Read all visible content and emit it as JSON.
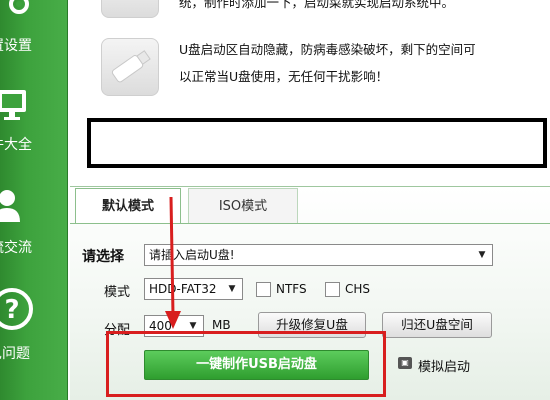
{
  "sidebar": {
    "items": [
      {
        "label": "置设置",
        "icon": "gear-icon"
      },
      {
        "label": "件大全",
        "icon": "monitor-icon"
      },
      {
        "label": "流交流",
        "icon": "user-icon"
      },
      {
        "label": "见问题",
        "icon": "question-icon"
      }
    ]
  },
  "features": {
    "line0": "统，制作时添加一下，启动菜就实现启动系统中。",
    "desc_line1": "U盘启动区自动隐藏，防病毒感染破坏，剩下的空间可",
    "desc_line2": "以正常当U盘使用，无任何干扰影响！",
    "usb_icon": "usb-drive-icon"
  },
  "tabs": [
    {
      "label": "默认模式",
      "active": true
    },
    {
      "label": "ISO模式",
      "active": false
    }
  ],
  "form": {
    "select_label": "请选择",
    "select_value": "请插入启动U盘!",
    "mode_label": "模式",
    "mode_value": "HDD-FAT32",
    "ntfs_label": "NTFS",
    "chs_label": "CHS",
    "alloc_label": "分配",
    "alloc_value": "400",
    "alloc_unit": "MB",
    "upgrade_button": "升级修复U盘",
    "restore_button": "归还U盘空间",
    "create_button": "一键制作USB启动盘",
    "simulate_label": "模拟启动"
  },
  "colors": {
    "sidebar_green": "#3da23d",
    "button_green": "#3aa83a",
    "annotation_red": "#d81e1e"
  }
}
